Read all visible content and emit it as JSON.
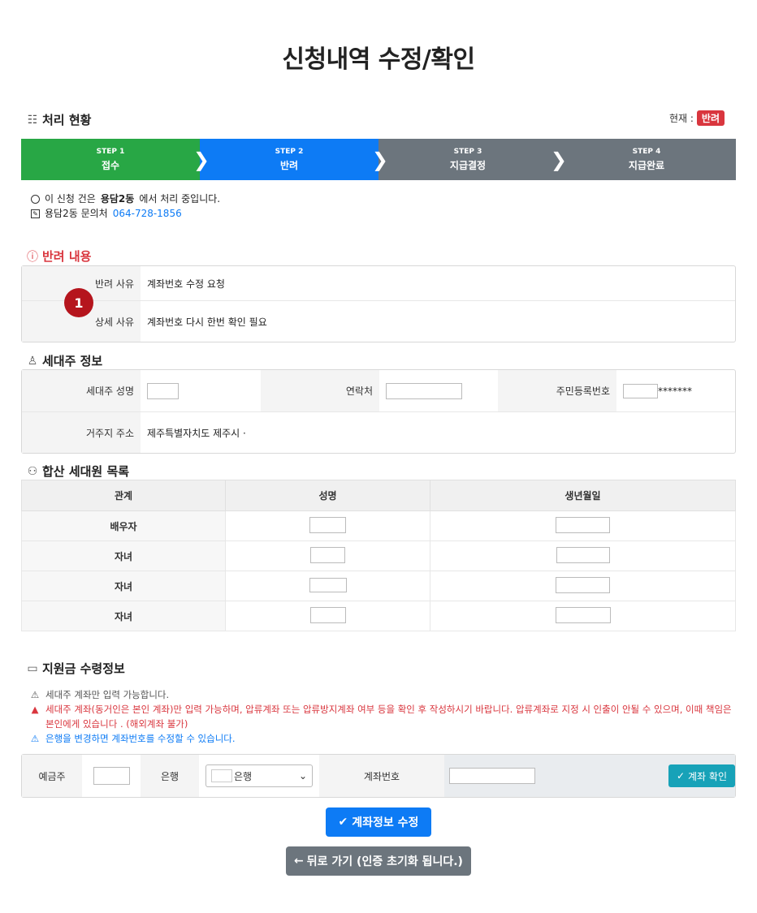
{
  "page_title": "신청내역 수정/확인",
  "status": {
    "heading": "처리 현황",
    "current_label": "현재 :",
    "current_badge": "반려",
    "steps": [
      {
        "num": "STEP 1",
        "label": "접수"
      },
      {
        "num": "STEP 2",
        "label": "반려"
      },
      {
        "num": "STEP 3",
        "label": "지급결정"
      },
      {
        "num": "STEP 4",
        "label": "지급완료"
      }
    ],
    "line1_pre": "이 신청 건은",
    "line1_office": "용담2동",
    "line1_post": "에서 처리 중입니다.",
    "line2_label": "용담2동 문의처",
    "line2_phone": "064-728-1856"
  },
  "rejection": {
    "heading": "반려 내용",
    "marker": "1",
    "reason_label": "반려 사유",
    "reason_value": "계좌번호 수정 요청",
    "detail_label": "상세 사유",
    "detail_value": "계좌번호 다시 한번 확인 필요"
  },
  "householder": {
    "heading": "세대주 정보",
    "name_label": "세대주 성명",
    "contact_label": "연락처",
    "rrn_label": "주민등록번호",
    "rrn_mask": "*******",
    "address_label": "거주지 주소",
    "address_value": "제주특별자치도 제주시 ·"
  },
  "members": {
    "heading": "합산 세대원 목록",
    "columns": [
      "관계",
      "성명",
      "생년월일"
    ],
    "rows": [
      {
        "relation": "배우자"
      },
      {
        "relation": "자녀"
      },
      {
        "relation": "자녀"
      },
      {
        "relation": "자녀"
      }
    ]
  },
  "payment": {
    "heading": "지원금 수령정보",
    "note1": "세대주 계좌만 입력 가능합니다.",
    "note2": "세대주 계좌(동거인은 본인 계좌)만 입력 가능하며, 압류계좌 또는 압류방지계좌 여부 등을 확인 후 작성하시기 바랍니다. 압류계좌로 지정 시 인출이 안될 수 있으며, 이때 책임은",
    "note2b": "본인에게 있습니다 . (해외계좌 불가)",
    "note3": "은행을 변경하면 계좌번호를 수정할 수 있습니다.",
    "holder_label": "예금주",
    "bank_label": "은행",
    "bank_selected": "은행",
    "account_label": "계좌번호",
    "verify_button": "계좌 확인"
  },
  "buttons": {
    "edit": "계좌정보 수정",
    "back": "뒤로 가기 (인증 초기화 됩니다.)"
  }
}
